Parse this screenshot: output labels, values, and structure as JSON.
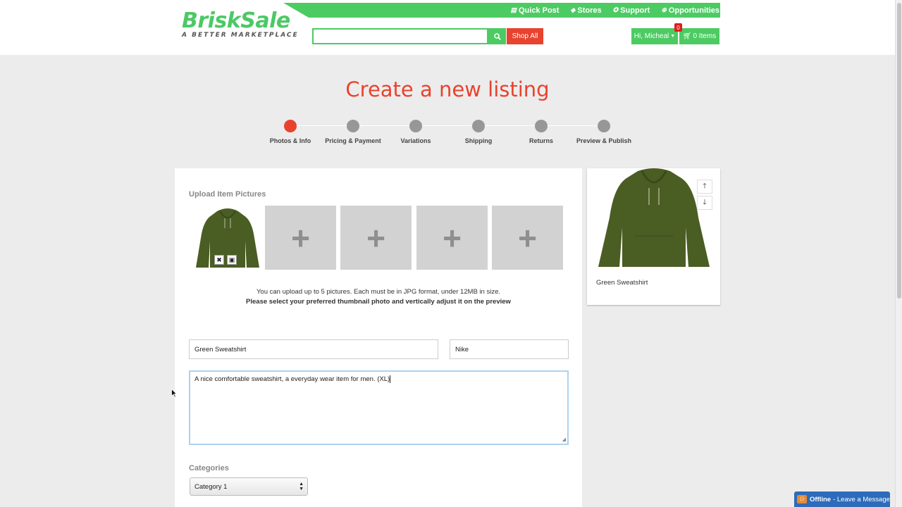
{
  "header": {
    "logo_main": "BriskSale",
    "logo_sub": "A BETTER MARKETPLACE",
    "links": [
      {
        "icon": "list-icon",
        "label": "Quick Post"
      },
      {
        "icon": "tag-icon",
        "label": "Stores"
      },
      {
        "icon": "support-icon",
        "label": "Support"
      },
      {
        "icon": "circle-plus-icon",
        "label": "Opportunities"
      }
    ],
    "search": {
      "value": "",
      "placeholder": ""
    },
    "shop_all": "Shop All",
    "user_label": "Hi, Micheal",
    "cart_label": "0 Items",
    "cart_count": "0"
  },
  "page": {
    "title": "Create a new listing"
  },
  "steps": [
    {
      "label": "Photos & Info",
      "active": true
    },
    {
      "label": "Pricing & Payment",
      "active": false
    },
    {
      "label": "Variations",
      "active": false
    },
    {
      "label": "Shipping",
      "active": false
    },
    {
      "label": "Returns",
      "active": false
    },
    {
      "label": "Preview & Publish",
      "active": false
    }
  ],
  "form": {
    "upload_label": "Upload Item Pictures",
    "upload_note": "You can upload up to 5 pictures. Each must be in JPG format, under 12MB in size.",
    "upload_note_bold": "Please select your preferred thumbnail photo and vertically adjust it on the preview",
    "title_value": "Green Sweatshirt",
    "brand_value": "Nike",
    "description_value": "A nice comfortable sweatshirt, a everyday wear item for men. (XL)",
    "categories_label": "Categories",
    "category_selected": "Category 1"
  },
  "preview": {
    "name": "Green Sweatshirt"
  },
  "chat": {
    "status": "Offline",
    "message": "- Leave a Message"
  },
  "colors": {
    "brand_green": "#4ccb63",
    "accent_red": "#e8432e",
    "step_inactive": "#979797",
    "hoodie": "#4a5d23"
  }
}
